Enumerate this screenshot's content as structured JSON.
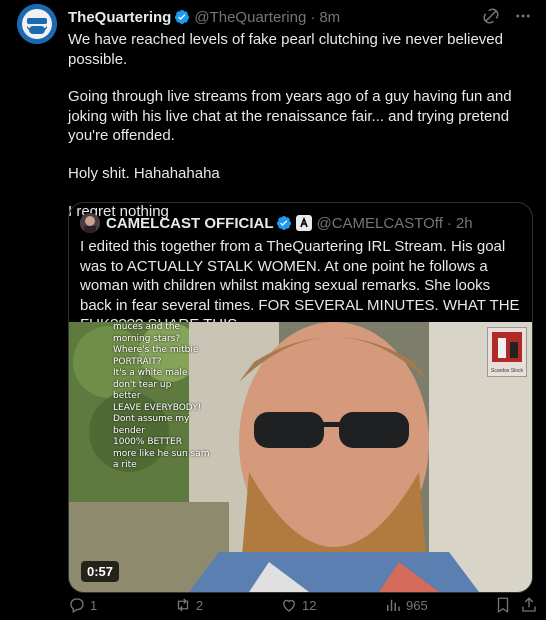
{
  "tweet": {
    "author_name": "TheQuartering",
    "author_handle": "@TheQuartering",
    "separator": "·",
    "time": "8m",
    "paragraphs": [
      "We have reached levels of fake pearl clutching ive never believed possible.",
      "Going through live streams from years ago of a guy having fun and joking with his live chat at the renaissance fair... and trying pretend you're offended.",
      "Holy shit. Hahahahaha",
      "I regret nothing"
    ]
  },
  "quote": {
    "author_name": "CAMELCAST OFFICIAL",
    "author_handle": "@CAMELCASTOff",
    "separator": "·",
    "time": "2h",
    "text": "I edited this together from a TheQuartering IRL Stream. His goal was to ACTUALLY STALK WOMEN. At one point he follows a woman with children whilst making sexual remarks. She looks back in fear several times. FOR SEVERAL MINUTES. WHAT THE FUK???? SHARE THIS",
    "video_duration": "0:57",
    "overlay_chat": [
      "muces and the",
      "morning stars?",
      "Where's the mitbie",
      "PORTRAIT?",
      "It's a white male",
      "don't tear up",
      "better",
      "LEAVE EVERYBODY!",
      "Dont assume my",
      "bender",
      "1000% BETTER",
      "more like he sun sam",
      "a rite"
    ],
    "logo_text": "Scardox Slock"
  },
  "actions": {
    "replies": "1",
    "reposts": "2",
    "likes": "12",
    "views": "965"
  },
  "colors": {
    "background": "#000000",
    "text": "#e7e9ea",
    "muted": "#71767b",
    "verified": "#1d9bf0",
    "border": "#2f3336"
  }
}
